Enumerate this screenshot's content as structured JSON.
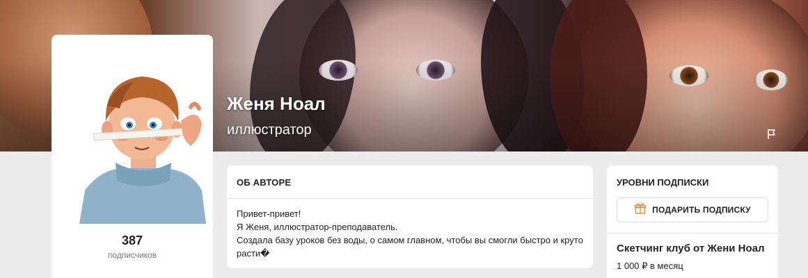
{
  "banner": {
    "author_name": "Женя Ноал",
    "author_role": "иллюстратор",
    "report_icon": "flag-icon"
  },
  "profile": {
    "subscribers_count": "387",
    "subscribers_label": "подписчиков",
    "avatar_icon": "avatar-illustration"
  },
  "about": {
    "title": "ОБ АВТОРЕ",
    "lines": [
      "Привет-привет!",
      "Я Женя, иллюстратор-преподаватель.",
      "Создала базу уроков без воды, о самом главном, чтобы вы смогли быстро и круто",
      "расти�"
    ]
  },
  "levels": {
    "title": "УРОВНИ ПОДПИСКИ",
    "gift_button_label": "ПОДАРИТЬ ПОДПИСКУ",
    "gift_icon": "gift-icon",
    "tier_name": "Скетчинг клуб от Жени Ноал",
    "tier_price": "1 000 ₽ в месяц"
  },
  "colors": {
    "page_bg": "#ececec",
    "card_bg": "#ffffff",
    "gift_accent": "#f0883a"
  }
}
